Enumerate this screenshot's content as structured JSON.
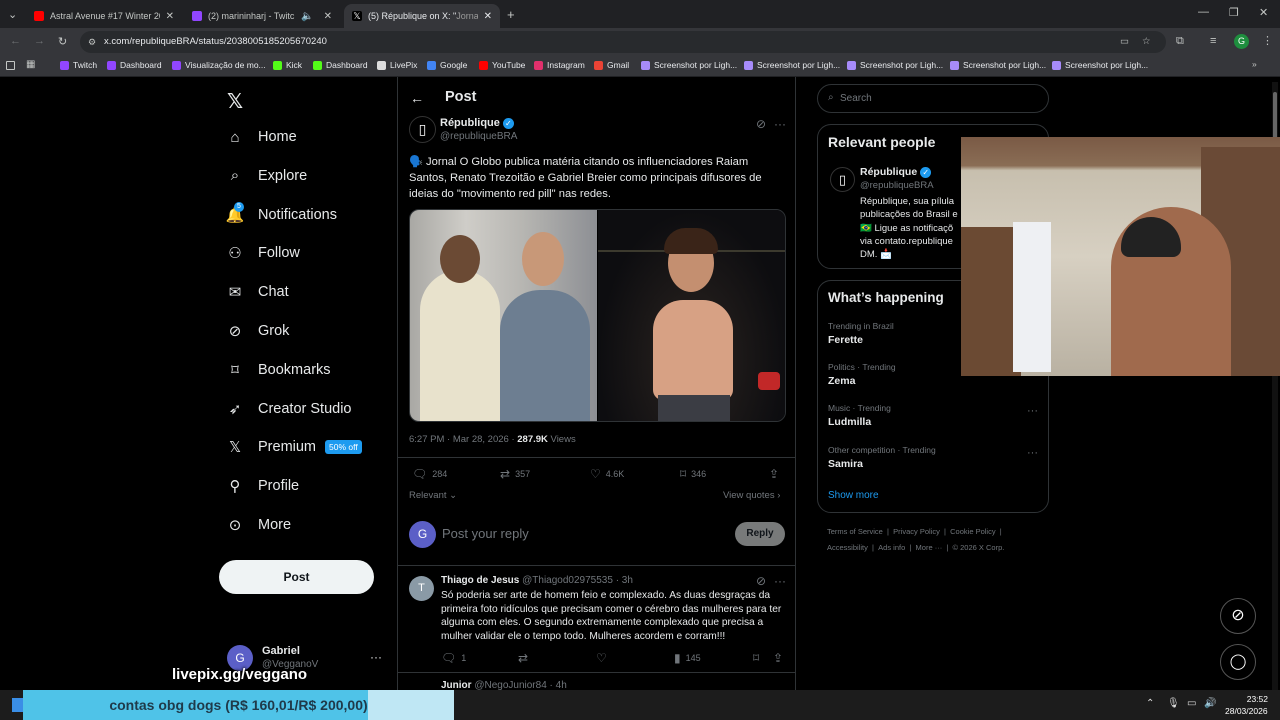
{
  "browser": {
    "tabs": [
      {
        "label": "Astral Avenue #17 Winter 2026",
        "color": "#ff0000"
      },
      {
        "label": "(2) marininharj - Twitch",
        "color": "#9146ff"
      },
      {
        "label": "(5) République on X: \"",
        "extra": "Jorna",
        "color": "#ffffff"
      }
    ],
    "url": "x.com/republiqueBRA/status/2038005185205670240",
    "bookmarks": [
      {
        "label": "Twitch",
        "color": "#9146ff"
      },
      {
        "label": "Dashboard",
        "color": "#9146ff"
      },
      {
        "label": "Visualização de mo...",
        "color": "#9146ff"
      },
      {
        "label": "Kick",
        "color": "#53fc18"
      },
      {
        "label": "Dashboard",
        "color": "#53fc18"
      },
      {
        "label": "LivePix",
        "color": "#dddddd"
      },
      {
        "label": "Google",
        "color": "#4285f4"
      },
      {
        "label": "YouTube",
        "color": "#ff0000"
      },
      {
        "label": "Instagram",
        "color": "#e1306c"
      },
      {
        "label": "Gmail",
        "color": "#ea4335"
      },
      {
        "label": "Screenshot por Ligh...",
        "color": "#a78bfa"
      },
      {
        "label": "Screenshot por Ligh...",
        "color": "#a78bfa"
      },
      {
        "label": "Screenshot por Ligh...",
        "color": "#a78bfa"
      },
      {
        "label": "Screenshot por Ligh...",
        "color": "#a78bfa"
      },
      {
        "label": "Screenshot por Ligh...",
        "color": "#a78bfa"
      }
    ]
  },
  "nav": {
    "items": [
      {
        "label": "Home",
        "icon": "home-icon"
      },
      {
        "label": "Explore",
        "icon": "search-icon"
      },
      {
        "label": "Notifications",
        "icon": "bell-icon",
        "badge": "5"
      },
      {
        "label": "Follow",
        "icon": "add-person-icon"
      },
      {
        "label": "Chat",
        "icon": "mail-icon"
      },
      {
        "label": "Grok",
        "icon": "grok-icon"
      },
      {
        "label": "Bookmarks",
        "icon": "bookmark-icon"
      },
      {
        "label": "Creator Studio",
        "icon": "rocket-icon"
      },
      {
        "label": "Premium",
        "icon": "x-icon",
        "badge": "50% off"
      },
      {
        "label": "Profile",
        "icon": "person-icon"
      },
      {
        "label": "More",
        "icon": "more-icon"
      }
    ],
    "post_button": "Post",
    "account": {
      "name": "Gabriel",
      "handle": "@VegganoV",
      "initial": "G"
    }
  },
  "post": {
    "header": "Post",
    "author": "République",
    "handle": "@republiqueBRA",
    "text_line1": "🗣️ Jornal O Globo publica matéria citando os influenciadores Raiam",
    "text_line2": "Santos, Renato Trezoitão e Gabriel Breier como principais difusores de",
    "text_line3": "ideias do \"movimento red pill\" nas redes.",
    "time": "6:27 PM · Mar 28, 2026 · ",
    "views": "287.9K",
    "views_label": " Views",
    "replies": "284",
    "reposts": "357",
    "likes": "4.6K",
    "bookmarks": "346",
    "sort": "Relevant",
    "view_quotes": "View quotes",
    "reply_placeholder": "Post your reply",
    "reply_button": "Reply",
    "reply_avatar": "G"
  },
  "comment": {
    "author": "Thiago de Jesus",
    "handle": "@Thiagod02975535",
    "time": "· 3h",
    "avatar": "T",
    "line1": "Só poderia ser arte de homem feio e complexado. As duas desgraças da",
    "line2": "primeira foto ridículos que precisam comer o cérebro das mulheres para ter",
    "line3": "alguma com eles. O segundo extremamente complexado que precisa a",
    "line4": "mulher validar ele o tempo todo. Mulheres acordem e corram!!!",
    "replies": "1",
    "views": "145",
    "next_author": "Junior",
    "next_handle": "@NegoJunior84 · 4h"
  },
  "sidebar": {
    "search_placeholder": "Search",
    "relevant_title": "Relevant people",
    "person_name": "République",
    "person_handle": "@republiqueBRA",
    "bio1": "République, sua pílula",
    "bio2": "publicações do Brasil e",
    "bio3": "🇧🇷 Ligue as notificaçõ",
    "bio4": "via contato.republique",
    "bio5": "DM. 📩",
    "happening_title": "What’s happening",
    "trends": [
      {
        "context": "Trending in Brazil",
        "name": "Ferette"
      },
      {
        "context": "Politics · Trending",
        "name": "Zema"
      },
      {
        "context": "Music · Trending",
        "name": "Ludmilla"
      },
      {
        "context": "Other competition · Trending",
        "name": "Samira"
      }
    ],
    "show_more": "Show more",
    "footer1": [
      "Terms of Service",
      "Privacy Policy",
      "Cookie Policy"
    ],
    "footer2": [
      "Accessibility",
      "Ads info",
      "More ···",
      "© 2026 X Corp."
    ]
  },
  "overlay": {
    "livepix": "livepix.gg/veggano",
    "goal_text": "contas obg dogs (R$ 160,01/R$ 200,00)",
    "goal_fraction": 0.8
  },
  "taskbar": {
    "time": "23:52",
    "date": "28/03/2026"
  }
}
